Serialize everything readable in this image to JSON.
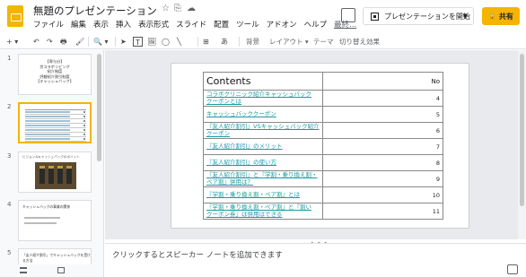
{
  "header": {
    "title": "無題のプレゼンテーション",
    "star_icon": "☆",
    "move_icon": "⎘",
    "cloud_icon": "☁",
    "menus": [
      "ファイル",
      "編集",
      "表示",
      "挿入",
      "表示形式",
      "スライド",
      "配置",
      "ツール",
      "アドオン",
      "ヘルプ",
      "最終..."
    ],
    "present_label": "プレゼンテーションを開始",
    "share_label": "共有",
    "share_lock_icon": "🔒"
  },
  "toolbar": {
    "new_slide": "+ ▾",
    "undo": "↶",
    "redo": "↷",
    "print": "🖶",
    "paint": "🖌",
    "zoom": "🔍 ▾",
    "select": "➤",
    "textbox": "T",
    "image": "🖼",
    "shape": "◯",
    "line": "╲",
    "comment": "⊞",
    "wordart": "あ",
    "background": "背景",
    "layout": "レイアウト ▾",
    "theme": "テーマ",
    "transition": "切り替え効果"
  },
  "filmstrip": {
    "slides": [
      {
        "num": "1",
        "text": "【寄与分】\n労コラボリビング\n紹介制度\n評額紹介割引制度\n【キャッシュバック】"
      },
      {
        "num": "2"
      },
      {
        "num": "3",
        "caption": "ビジョン&キャッシュバックのポイント"
      },
      {
        "num": "4",
        "caption": "キャッシュバックの事業の関係"
      },
      {
        "num": "5",
        "caption": "「友人紹介割引」でキャッシュバックを受ける方法"
      }
    ]
  },
  "slide": {
    "header_left": "Contents",
    "header_right": "No",
    "rows": [
      {
        "title": "コラボクリニック紹介キャッシュバック\nクーポンとは",
        "no": "4"
      },
      {
        "title": "キャッシュバッククーポン",
        "no": "5"
      },
      {
        "title": "『友人紹介割引』VSキャッシュバック紹介\nクーポン",
        "no": "6"
      },
      {
        "title": "『友人紹介割引』のメリット",
        "no": "7"
      },
      {
        "title": "『友人紹介割引』の使い方",
        "no": "8"
      },
      {
        "title": "『友人紹介割引』と『学割・乗り換え割・\nペア割』併用は？",
        "no": "9"
      },
      {
        "title": "『学割・乗り換え割・ペア割』とは",
        "no": "10"
      },
      {
        "title": "『学割・乗り換え割・ペア割』と『割い\nクーポン券』は併用はできる",
        "no": "11"
      }
    ]
  },
  "notes": {
    "placeholder": "クリックするとスピーカー ノートを追加できます"
  },
  "colors": {
    "accent": "#f4b400",
    "link": "#1a9aa0"
  }
}
